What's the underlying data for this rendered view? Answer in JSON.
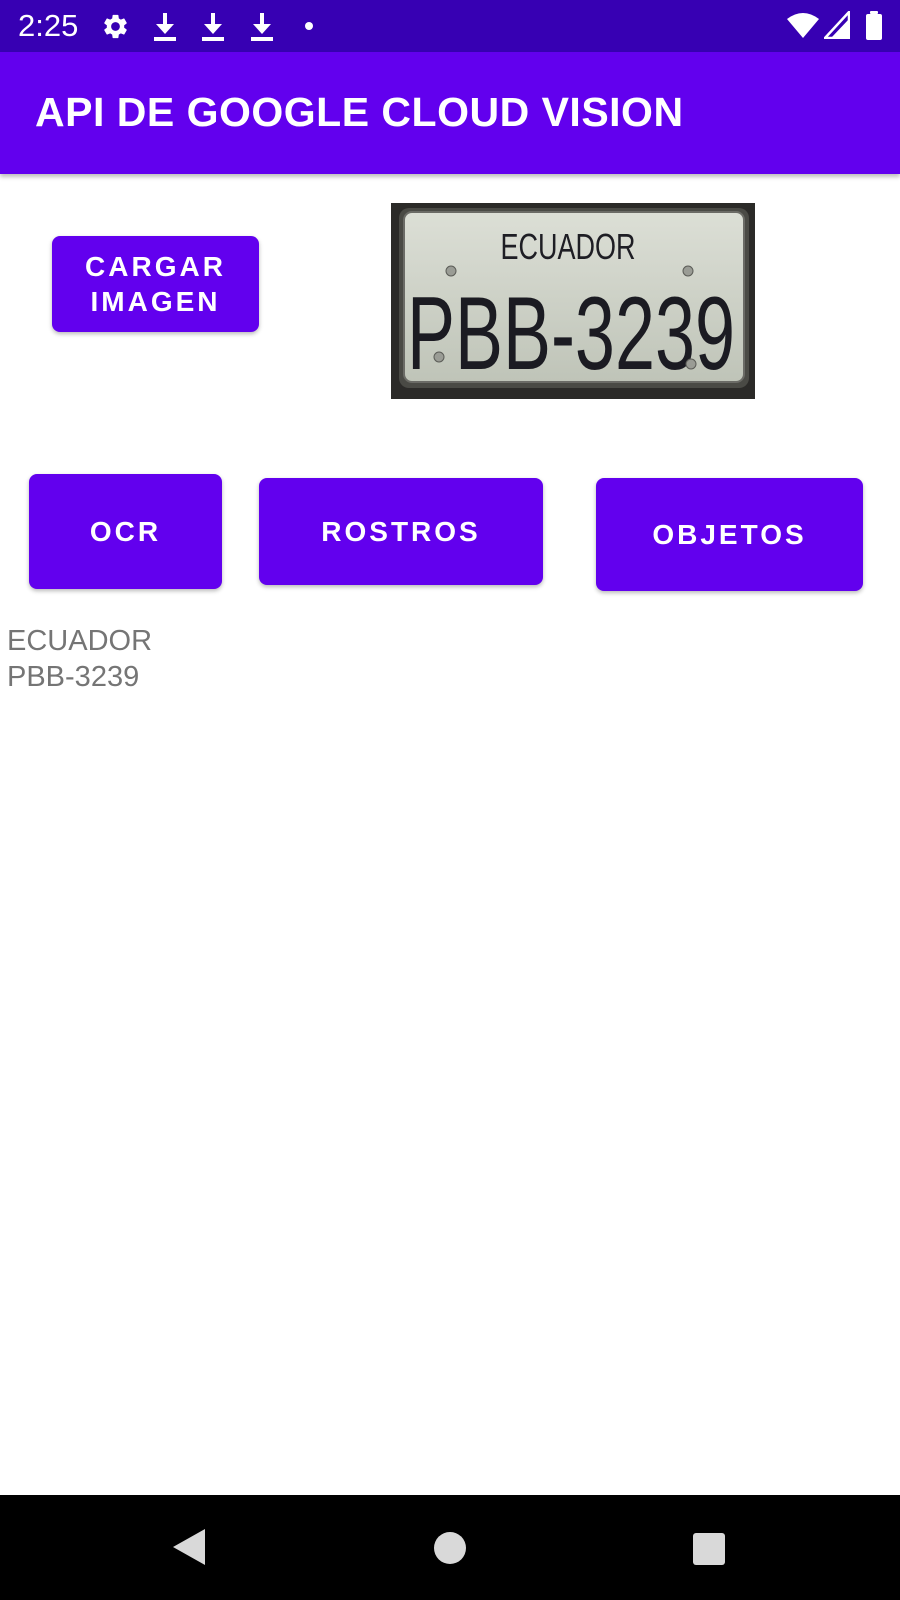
{
  "status_bar": {
    "time": "2:25",
    "left_icons": [
      "settings-icon",
      "download-icon",
      "download-icon",
      "download-icon",
      "notification-dot-icon"
    ],
    "right_icons": [
      "wifi-icon",
      "cell-signal-icon",
      "battery-icon"
    ],
    "background_color": "#3700b3"
  },
  "app_bar": {
    "title": "API DE GOOGLE CLOUD VISION",
    "background_color": "#6200ee"
  },
  "actions": {
    "load_image_label": "CARGAR IMAGEN",
    "ocr_label": "OCR",
    "faces_label": "ROSTROS",
    "objects_label": "OBJETOS",
    "button_color": "#6200ee"
  },
  "preview_image": {
    "plate_country": "ECUADOR",
    "plate_number": "PBB-3239"
  },
  "result": {
    "lines": [
      "ECUADOR",
      "PBB-3239"
    ],
    "text_color": "#757575"
  },
  "nav_bar": {
    "buttons": [
      "back-icon",
      "home-icon",
      "recents-icon"
    ]
  }
}
